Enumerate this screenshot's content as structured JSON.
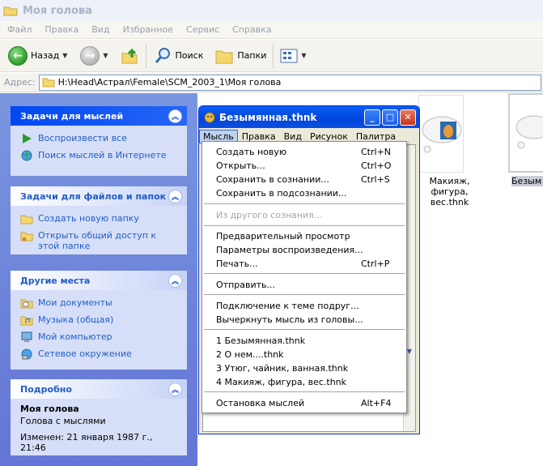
{
  "window": {
    "title": "Моя голова"
  },
  "menu": [
    "Файл",
    "Правка",
    "Вид",
    "Избранное",
    "Сервис",
    "Справка"
  ],
  "toolbar": {
    "back": "Назад",
    "search": "Поиск",
    "folders": "Папки"
  },
  "address": {
    "label": "Адрес:",
    "path": "H:\\Head\\Астрал\\Female\\SCM_2003_1\\Моя голова"
  },
  "panels": {
    "thoughts": {
      "title": "Задачи для мыслей",
      "items": [
        "Воспроизвести все",
        "Поиск мыслей в Интернете"
      ]
    },
    "files": {
      "title": "Задачи для файлов и папок",
      "items": [
        "Создать новую папку",
        "Открыть общий доступ к этой папке"
      ]
    },
    "places": {
      "title": "Другие места",
      "items": [
        "Мои документы",
        "Музыка (общая)",
        "Мой компьютер",
        "Сетевое окружение"
      ]
    },
    "details": {
      "title": "Подробно",
      "name": "Моя голова",
      "type": "Голова с мыслями",
      "modified": "Изменен: 21 января 1987 г., 21:46"
    }
  },
  "files": [
    {
      "caption": "Макияж, фигура, вес.thnk"
    },
    {
      "caption": "Безым"
    }
  ],
  "dialog": {
    "title": "Безымянная.thnk",
    "menu": [
      "Мысль",
      "Правка",
      "Вид",
      "Рисунок",
      "Палитра"
    ],
    "dropdown": {
      "items": [
        {
          "label": "Создать новую",
          "shortcut": "Ctrl+N"
        },
        {
          "label": "Открыть...",
          "shortcut": "Ctrl+O"
        },
        {
          "label": "Сохранить в сознании...",
          "shortcut": "Ctrl+S"
        },
        {
          "label": "Сохранить в подсознании...",
          "shortcut": ""
        },
        {
          "label": "Из другого сознания...",
          "shortcut": "",
          "disabled": true
        },
        {
          "label": "Предварительный просмотр",
          "shortcut": ""
        },
        {
          "label": "Параметры воспроизведения...",
          "shortcut": ""
        },
        {
          "label": "Печать...",
          "shortcut": "Ctrl+P"
        },
        {
          "label": "Отправить...",
          "shortcut": ""
        },
        {
          "label": "Подключение к теме подруг...",
          "shortcut": ""
        },
        {
          "label": "Вычеркнуть мысль из головы...",
          "shortcut": ""
        },
        {
          "label": "1 Безымянная.thnk",
          "shortcut": ""
        },
        {
          "label": "2 О нем....thnk",
          "shortcut": ""
        },
        {
          "label": "3 Утюг, чайник, ванная.thnk",
          "shortcut": ""
        },
        {
          "label": "4 Макияж, фигура, вес.thnk",
          "shortcut": ""
        },
        {
          "label": "Остановка мыслей",
          "shortcut": "Alt+F4"
        }
      ]
    }
  },
  "colors": {
    "title_bar": "#0a5ef7",
    "task_pane": "#6f86dc",
    "link": "#215dc6"
  }
}
